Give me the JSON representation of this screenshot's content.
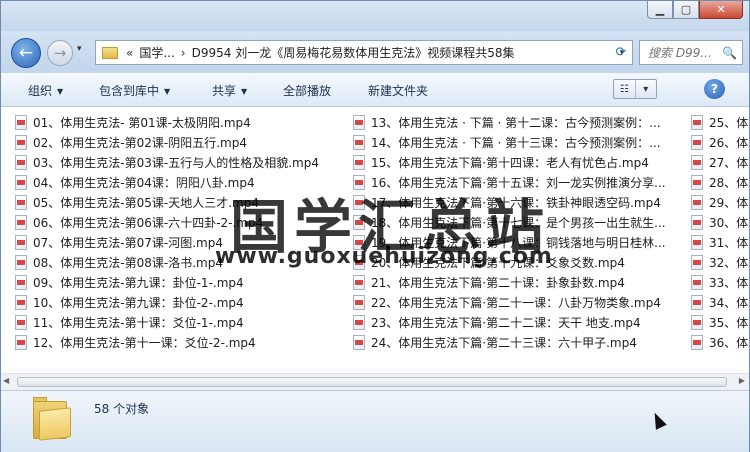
{
  "window": {
    "minimize": "▁",
    "maximize": "▢",
    "close": "✕"
  },
  "nav": {
    "back_icon": "←",
    "forward_icon": "→",
    "history_icon": "▾",
    "address": {
      "chevron": "«",
      "segments": [
        "国学...",
        "D9954 刘一龙《周易梅花易数体用生克法》视频课程共58集"
      ],
      "separator": "›",
      "dropdown": "▾"
    },
    "refresh_icon": "⟳",
    "search_placeholder": "搜索 D99...",
    "search_icon": "🔍"
  },
  "toolbar": {
    "organize": "组织",
    "include_library": "包含到库中",
    "share": "共享",
    "play_all": "全部播放",
    "new_folder": "新建文件夹",
    "dropdown_arrow": "▼",
    "view_icon": "☷",
    "view_drop": "▾",
    "help": "?"
  },
  "files": {
    "col1": [
      "01、体用生克法- 第01课-太极阴阳.mp4",
      "02、体用生克法-第02课-阴阳五行.mp4",
      "03、体用生克法-第03课-五行与人的性格及相貌.mp4",
      "04、体用生克法-第04课：阴阳八卦.mp4",
      "05、体用生克法-第05课-天地人三才.mp4",
      "06、体用生克法-第06课-六十四卦-2-.mp4",
      "07、体用生克法-第07课-河图.mp4",
      "08、体用生克法-第08课-洛书.mp4",
      "09、体用生克法-第九课：卦位-1-.mp4",
      "10、体用生克法-第九课：卦位-2-.mp4",
      "11、体用生克法-第十课：爻位-1-.mp4",
      "12、体用生克法-第十一课：爻位-2-.mp4"
    ],
    "col2": [
      "13、体用生克法 · 下篇 · 第十二课：古今预测案例：...",
      "14、体用生克法 · 下篇 · 第十三课：古今预测案例：...",
      "15、体用生克法下篇·第十四课：老人有忧色占.mp4",
      "16、体用生克法下篇·第十五课：刘一龙实例推演分享...",
      "17、体用生克法下篇·第十六课：铁卦神眼透空码.mp4",
      "18、体用生克法下篇·第十七课：是个男孩一出生就生...",
      "19、体用生克法下篇·第十八课：铜钱落地与明日桂林...",
      "20、体用生克法下篇·第十九课：爻象爻数.mp4",
      "21、体用生克法下篇·第二十课：卦象卦数.mp4",
      "22、体用生克法下篇·第二十一课：八卦万物类象.mp4",
      "23、体用生克法下篇·第二十二课：天干 地支.mp4",
      "24、体用生克法下篇·第二十三课：六十甲子.mp4"
    ],
    "col3": [
      "25、体",
      "26、体",
      "27、体",
      "28、体",
      "29、体",
      "30、体",
      "31、体",
      "32、体",
      "33、体",
      "34、体",
      "35、体",
      "36、体"
    ]
  },
  "scrollbar": {
    "left": "◀",
    "right": "▶"
  },
  "details": {
    "count": "58 个对象"
  },
  "watermark": {
    "cn": "国学汇总站",
    "url": "www.guoxuehuizong.com"
  }
}
